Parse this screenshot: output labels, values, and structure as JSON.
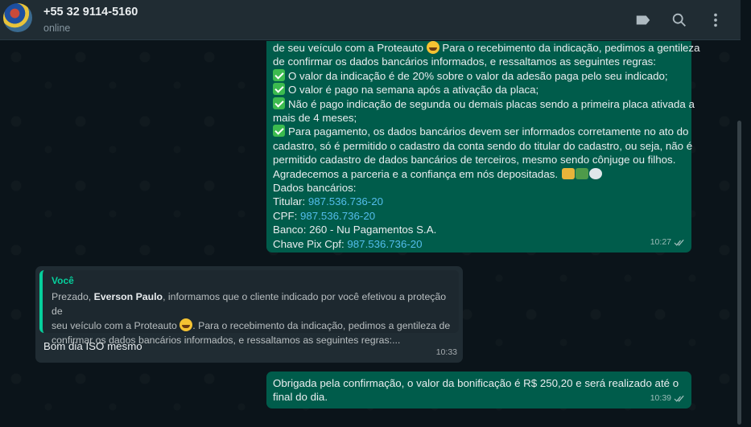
{
  "header": {
    "contact_name": "+55 32 9114-5160",
    "status": "online",
    "icons": [
      "label-icon",
      "search-icon",
      "menu-icon"
    ]
  },
  "messages": {
    "first": {
      "lines": [
        "de seu veículo com a Proteauto",
        " Para o recebimento da indicação, pedimos a gentileza",
        "de confirmar os dados bancários informados, e ressaltamos as seguintes regras:",
        "O valor da indicação é de 20% sobre o valor da adesão paga pelo seu indicado;",
        "O valor é pago na semana após a ativação da placa;",
        "Não é pago indicação de segunda ou demais placas sendo a primeira placa ativada a",
        "mais de 4 meses;",
        "Para pagamento, os dados bancários devem ser informados corretamente no ato do",
        "cadastro, só é permitido o cadastro da conta sendo do titular do cadastro, ou seja, não é",
        "permitido cadastro de dados bancários de terceiros, mesmo sendo cônjuge ou filhos.",
        "Agradecemos a parceria e a confiança em nós depositadas.",
        "Dados bancários:",
        "Titular: ",
        "CPF: ",
        "Banco: 260 - Nu Pagamentos S.A.",
        "Chave Pix Cpf: "
      ],
      "cpf_value": "987.536.736-20",
      "time": "10:27"
    },
    "reply": {
      "quote_author": "Você",
      "quote_prefix": "Prezado, ",
      "quote_bold": "Everson Paulo",
      "quote_line1_rest": ", informamos que o cliente indicado por você efetivou a proteção de",
      "quote_line2a": "seu veículo com a Proteauto",
      "quote_line2b": ". Para o recebimento da indicação, pedimos a gentileza de",
      "quote_line3": "confirmar os dados bancários informados, e ressaltamos as seguintes regras:...",
      "body": "Bom dia ISO mesmo",
      "time": "10:33"
    },
    "last": {
      "line1": "Obrigada pela confirmação, o valor da bonificação é R$ 250,20 e será realizado até o",
      "line2": "final do dia.",
      "time": "10:39"
    }
  }
}
